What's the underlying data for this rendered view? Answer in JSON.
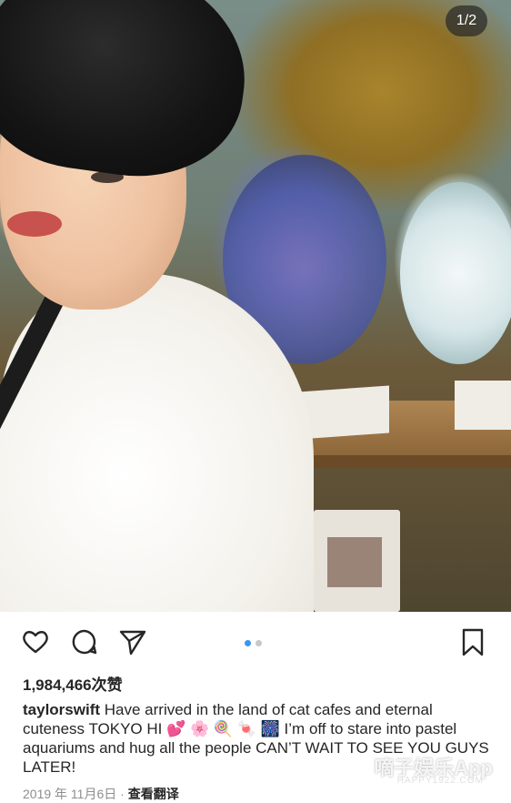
{
  "photo": {
    "counter": "1/2"
  },
  "actions": {
    "like_icon": "heart-icon",
    "comment_icon": "comment-bubble-icon",
    "share_icon": "paper-plane-icon",
    "save_icon": "bookmark-icon"
  },
  "carousel": {
    "active_index": 0,
    "total": 2,
    "active_color": "#3897f0",
    "inactive_color": "#c7c7c7"
  },
  "post": {
    "likes": "1,984,466次赞",
    "username": "taylorswift",
    "caption": " Have arrived in the land of cat cafes and eternal cuteness TOKYO HI 💕 🌸 🍭 🍬 🎆 I’m off to stare into pastel aquariums and hug all the people CAN’T WAIT TO SEE YOU GUYS LATER!",
    "date": "2019 年 11月6日",
    "separator": " · ",
    "translate": "查看翻译"
  },
  "watermark": {
    "text": "嘀子娱乐App",
    "sub": "HAPPY1922.COM"
  }
}
